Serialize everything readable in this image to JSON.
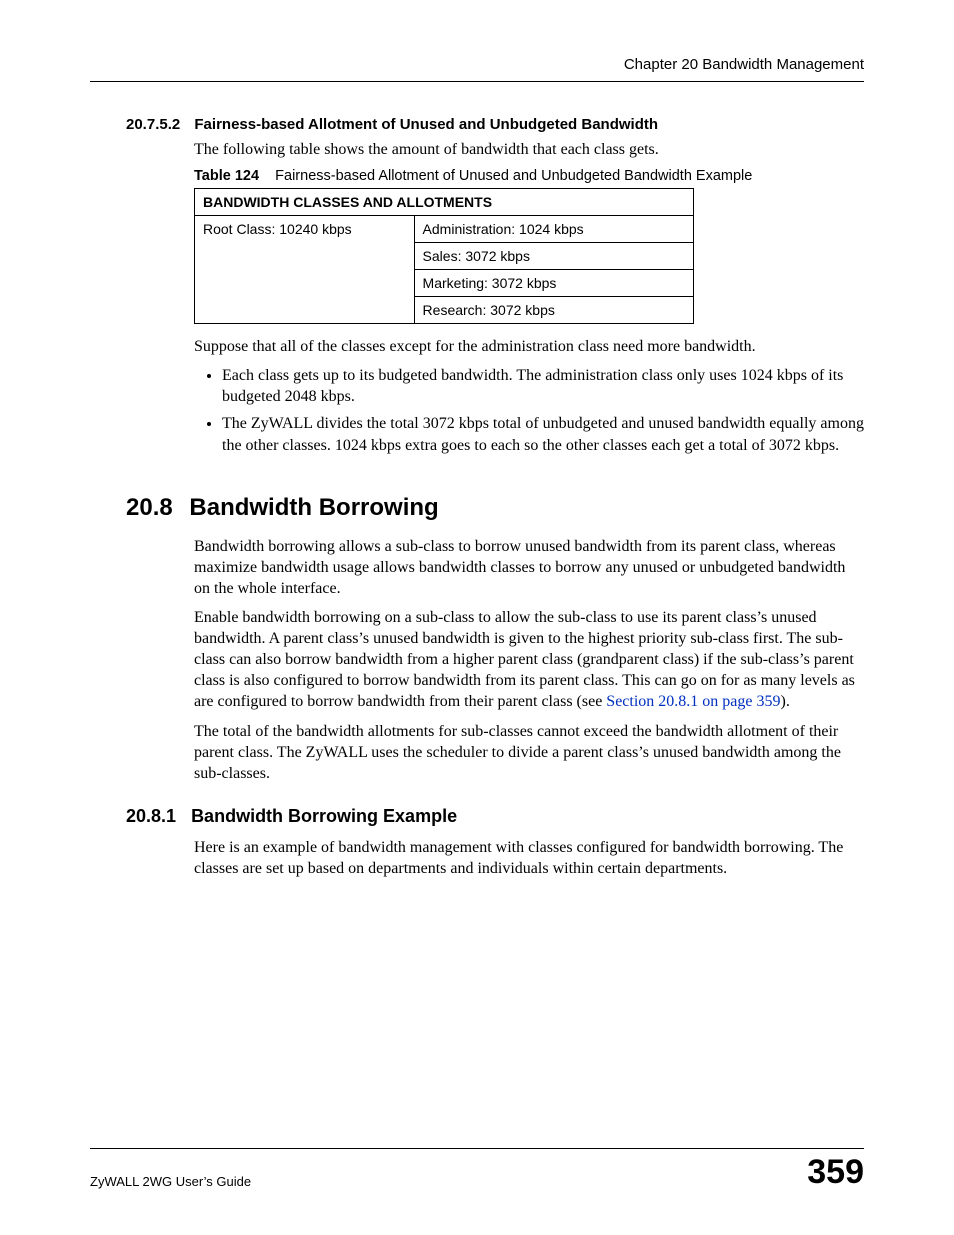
{
  "header": {
    "running_head": "Chapter 20 Bandwidth Management"
  },
  "sections": {
    "s207_5_2": {
      "number": "20.7.5.2",
      "title": "Fairness-based Allotment of Unused and Unbudgeted Bandwidth",
      "intro": "The following table shows the amount of bandwidth that each class gets.",
      "table_caption_label": "Table 124",
      "table_caption_text": "Fairness-based Allotment of Unused and Unbudgeted Bandwidth Example",
      "table_header": "BANDWIDTH CLASSES AND ALLOTMENTS",
      "root_class": "Root Class: 10240 kbps",
      "allotments": [
        "Administration: 1024 kbps",
        "Sales: 3072 kbps",
        "Marketing: 3072 kbps",
        "Research: 3072 kbps"
      ],
      "after_table": "Suppose that all of the classes except for the administration class need more bandwidth.",
      "bullets": [
        "Each class gets up to its budgeted bandwidth. The administration class only uses 1024 kbps of its budgeted 2048 kbps.",
        "The ZyWALL divides the total 3072 kbps total of unbudgeted and unused bandwidth equally among the other classes. 1024 kbps extra goes to each so the other classes each get a total of 3072 kbps."
      ]
    },
    "s208": {
      "number": "20.8",
      "title": "Bandwidth Borrowing",
      "p1": "Bandwidth borrowing allows a sub-class to borrow unused bandwidth from its parent class, whereas maximize bandwidth usage allows bandwidth classes to borrow any unused or unbudgeted bandwidth on the whole interface.",
      "p2a": "Enable bandwidth borrowing on a sub-class to allow the sub-class to use its parent class’s unused bandwidth. A parent class’s unused bandwidth is given to the highest priority sub-class first. The sub-class can also borrow bandwidth from a higher parent class (grandparent class) if the sub-class’s parent class is also configured to borrow bandwidth from its parent class. This can go on for as many levels as are configured to borrow bandwidth from their parent class (see ",
      "p2_link": "Section 20.8.1 on page 359",
      "p2b": ").",
      "p3": "The total of the bandwidth allotments for sub-classes cannot exceed the bandwidth allotment of their parent class. The ZyWALL uses the scheduler to divide a parent class’s unused bandwidth among the sub-classes."
    },
    "s208_1": {
      "number": "20.8.1",
      "title": "Bandwidth Borrowing Example",
      "p1": "Here is an example of bandwidth management with classes configured for bandwidth borrowing. The classes are set up based on departments and individuals within certain departments."
    }
  },
  "footer": {
    "guide": "ZyWALL 2WG User’s Guide",
    "page": "359"
  }
}
